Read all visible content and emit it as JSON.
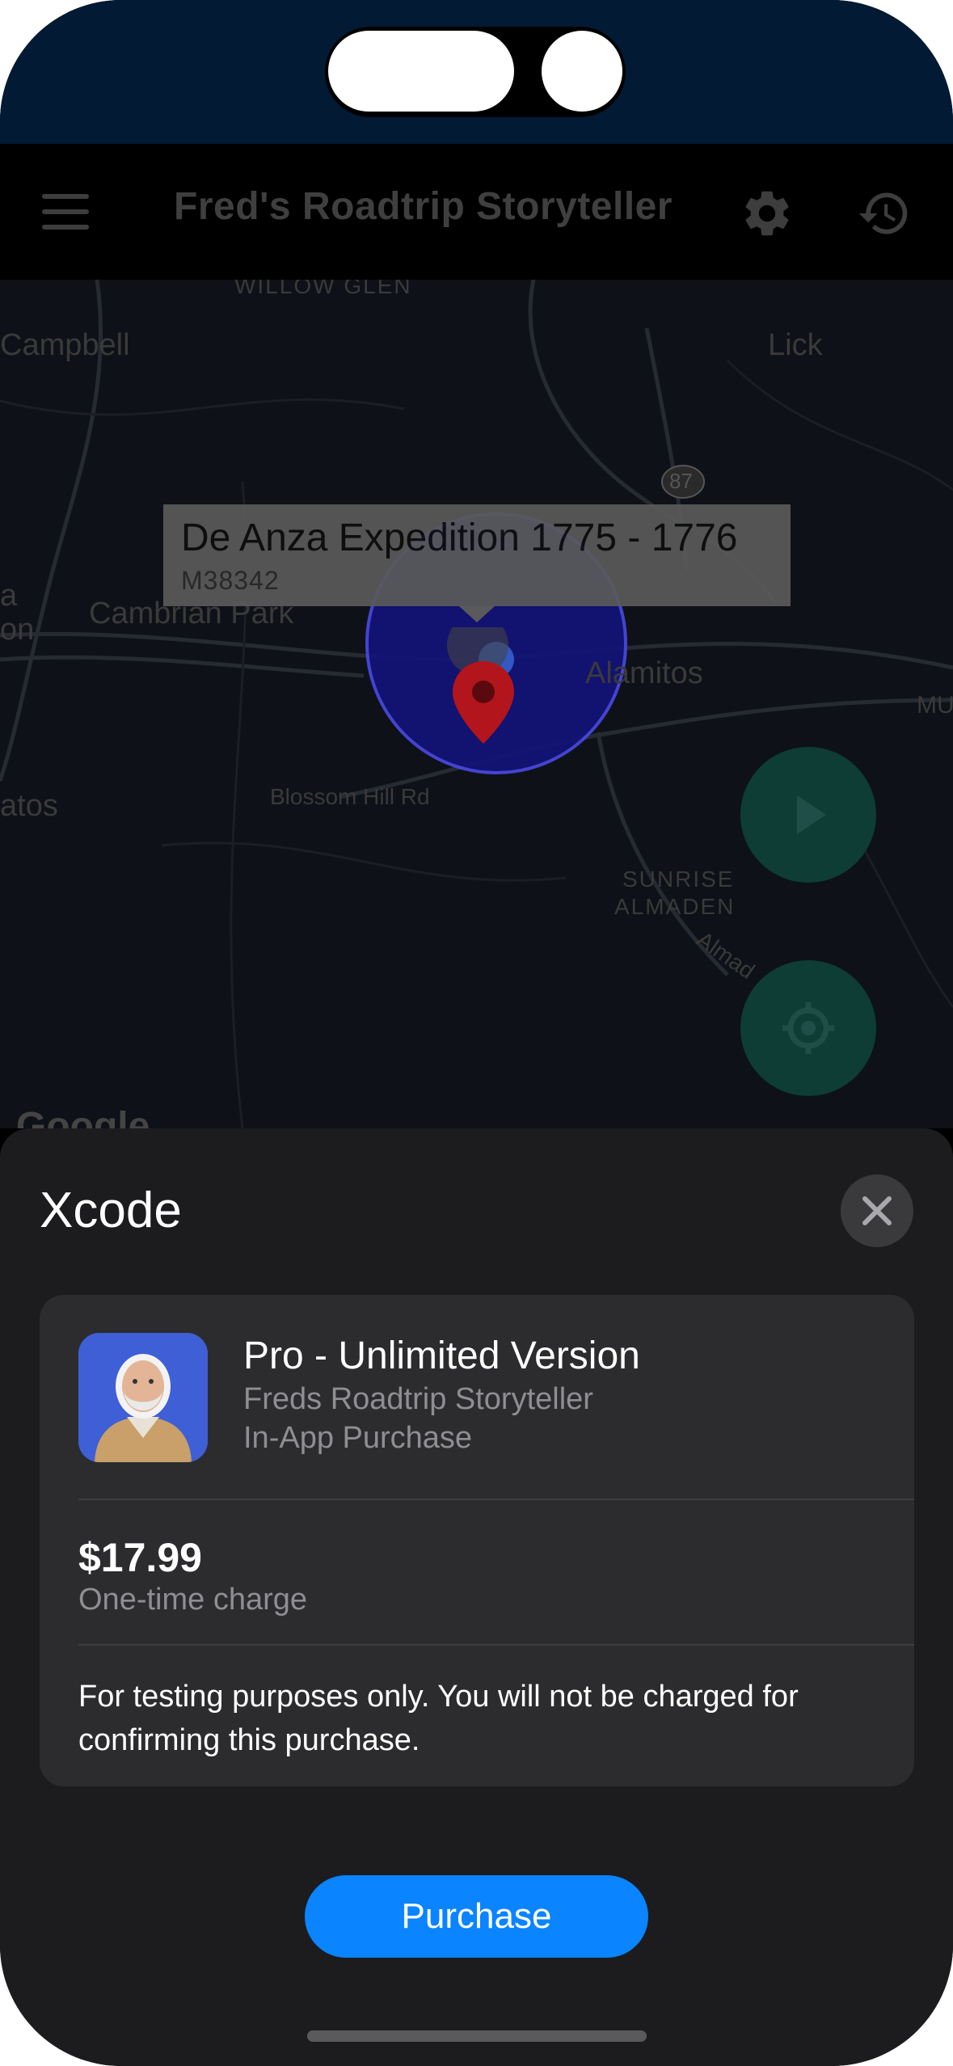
{
  "app_bar": {
    "title": "Fred's Roadtrip Storyteller",
    "icons": [
      "menu-icon",
      "settings-gear-icon",
      "history-icon"
    ]
  },
  "map": {
    "labels": {
      "willow_glen": "WILLOW GLEN",
      "campbell": "Campbell",
      "lick": "Lick",
      "route": "87",
      "cambrian_park": "Cambrian Park",
      "alamitos": "Alamitos",
      "blossom_hill": "Blossom Hill Rd",
      "atos": "atos",
      "sunrise": "SUNRISE",
      "almaden": "ALMADEN",
      "almad": "Almad",
      "left_a": "a",
      "left_on": "on",
      "right_mu": "MU"
    },
    "callout": {
      "title": "De Anza Expedition 1775 - 1776",
      "subtitle": "M38342"
    },
    "attribution": "Google",
    "buttons": [
      "play-icon",
      "my-location-icon"
    ]
  },
  "sheet": {
    "title": "Xcode",
    "product": {
      "name": "Pro - Unlimited Version",
      "app": "Freds Roadtrip Storyteller",
      "type": "In-App Purchase"
    },
    "price": "$17.99",
    "charge_note": "One-time charge",
    "notice": "For testing purposes only. You will not be charged for confirming this purchase.",
    "purchase_label": "Purchase"
  },
  "colors": {
    "accent": "#0a84ff",
    "sheet_bg": "#1c1c1e",
    "card_bg": "#2c2c2e",
    "status_bar": "#021a33",
    "fab": "#0d3d35",
    "marker_red": "#b3151c"
  }
}
